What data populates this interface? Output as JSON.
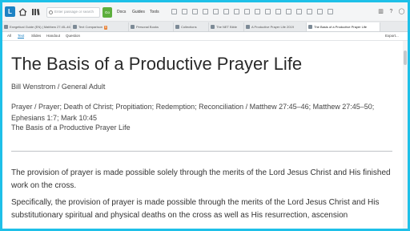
{
  "toolbar": {
    "search_placeholder": "Enter passage or search",
    "go_label": "Go",
    "menus": [
      "Docs",
      "Guides",
      "Tools"
    ]
  },
  "tabs": [
    {
      "label": "Exegetical Guide (EN) | Matthew 27:45–46",
      "badge": "5"
    },
    {
      "label": "Text Comparison",
      "badge": "5"
    },
    {
      "label": "Personal Books",
      "badge": ""
    },
    {
      "label": "Collections",
      "badge": ""
    },
    {
      "label": "The NET Bible",
      "badge": ""
    },
    {
      "label": "A Productive Prayer Life 2019",
      "badge": ""
    },
    {
      "label": "The Basis of a Productive Prayer Life",
      "badge": ""
    }
  ],
  "subtabs": [
    "All",
    "Text",
    "Slides",
    "Handout",
    "Question"
  ],
  "export_label": "Export...",
  "document": {
    "title": "The Basis of a Productive Prayer Life",
    "author": "Bill Wenstrom / General Adult",
    "topics": "Prayer / Prayer; Death of Christ; Propitiation; Redemption; Reconciliation / Matthew 27:45–46; Matthew 27:45–50; Ephesians 1:7; Mark 10:45",
    "subtitle": "The Basis of a Productive Prayer Life",
    "paragraph1": "The provision of prayer is made possible solely through the merits of the Lord Jesus Christ and His finished work on the cross.",
    "paragraph2": "Specifically, the provision of prayer is made possible through the merits of the Lord Jesus Christ and His substitutionary spiritual and physical deaths on the cross as well as His resurrection, ascension"
  }
}
